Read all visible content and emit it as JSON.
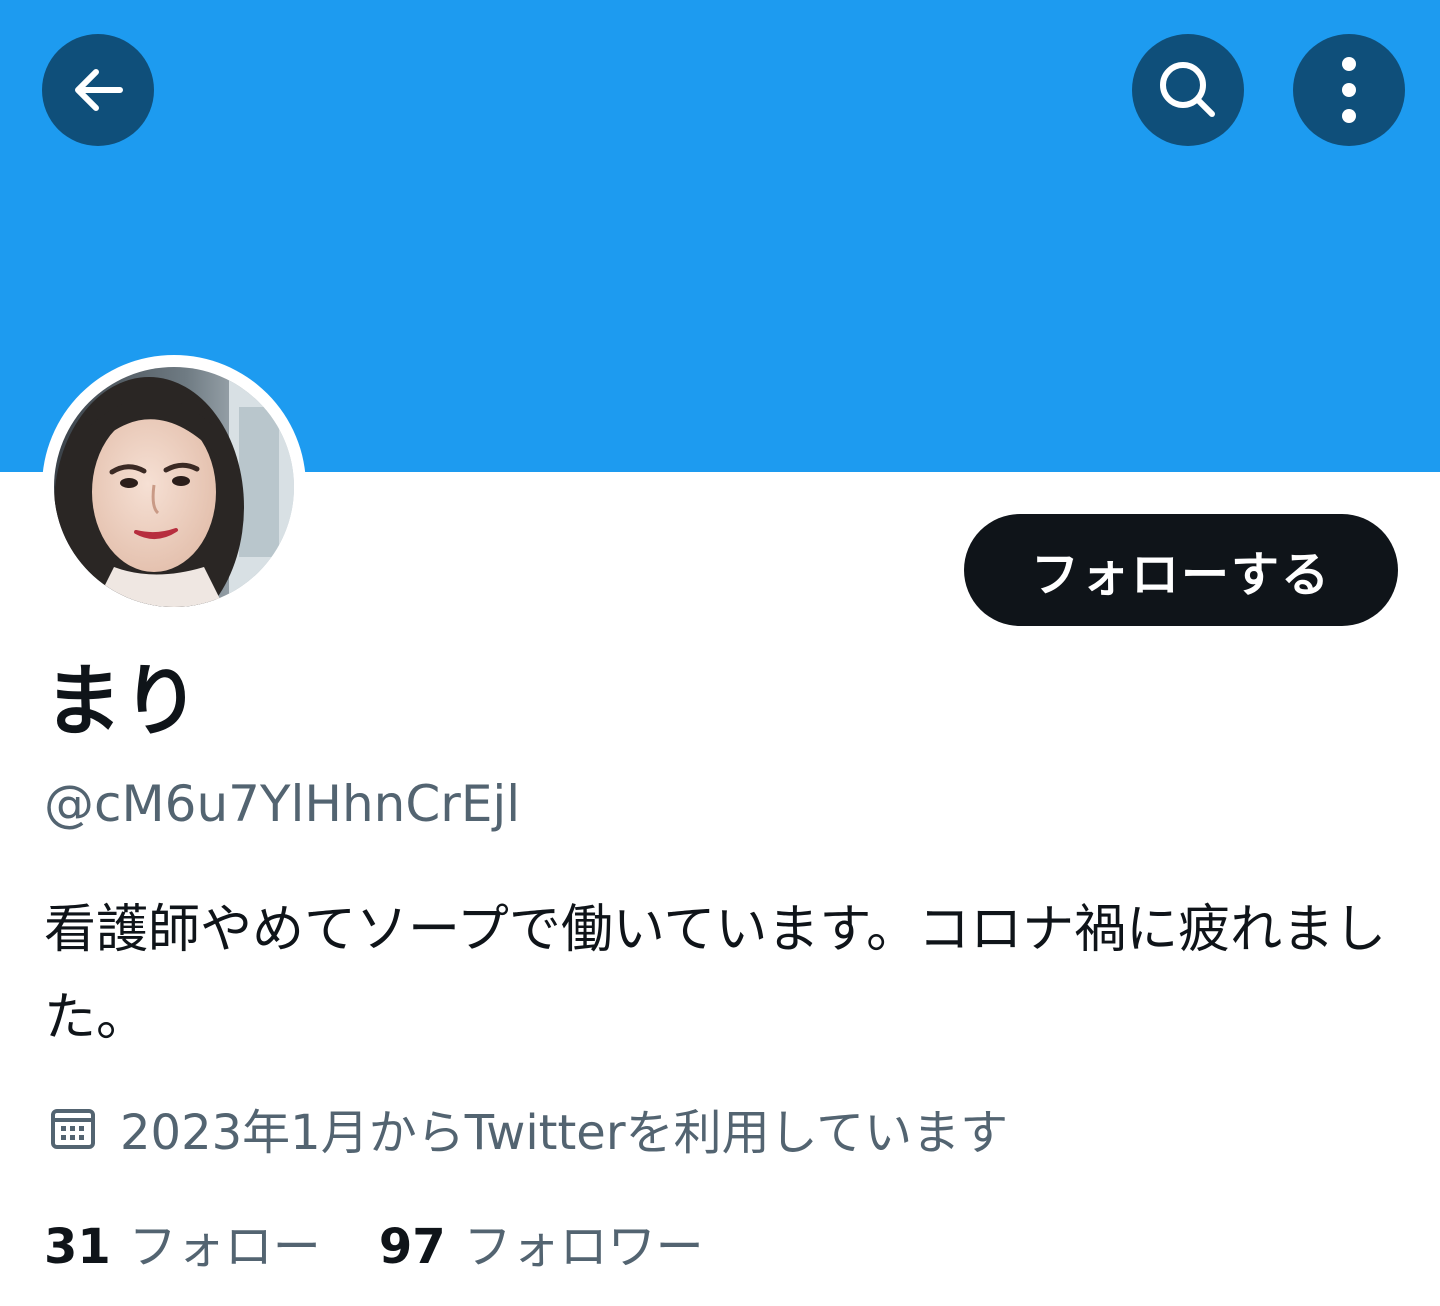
{
  "colors": {
    "banner": "#1d9bf0",
    "header_button_bg": "#0f4f7a",
    "follow_button_bg": "#0f1419",
    "text_primary": "#0f1419",
    "text_secondary": "#536471"
  },
  "header": {
    "back_icon": "arrow-left-icon",
    "search_icon": "search-icon",
    "more_icon": "more-vertical-icon"
  },
  "profile": {
    "avatar_icon": "profile-photo",
    "follow_label": "フォローする",
    "display_name": "まり",
    "handle": "@cM6u7YlHhnCrEjl",
    "bio": "看護師やめてソープで働いています。コロナ禍に疲れました。",
    "joined_icon": "calendar-icon",
    "joined": "2023年1月からTwitterを利用しています",
    "following_count": "31",
    "following_label": "フォロー",
    "followers_count": "97",
    "followers_label": "フォロワー"
  }
}
